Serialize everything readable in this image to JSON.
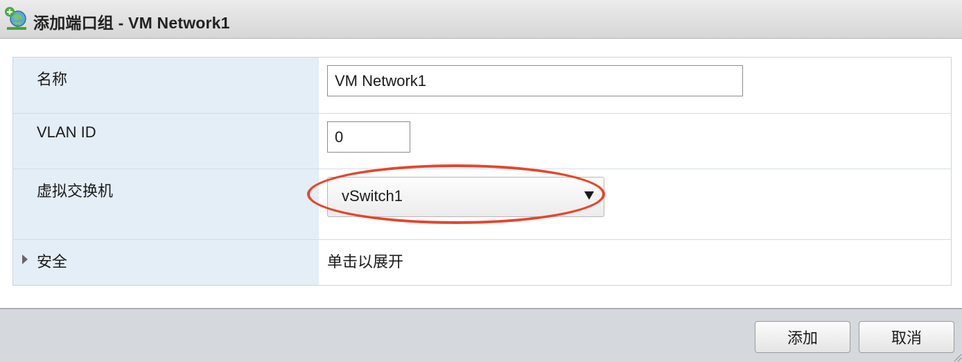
{
  "dialog": {
    "title": "添加端口组 - VM Network1",
    "icon": "network-add-icon"
  },
  "form": {
    "name": {
      "label": "名称",
      "value": "VM Network1"
    },
    "vlan_id": {
      "label": "VLAN ID",
      "value": "0"
    },
    "virtual_switch": {
      "label": "虚拟交换机",
      "selected": "vSwitch1"
    },
    "security": {
      "label": "安全",
      "expand_hint": "单击以展开"
    }
  },
  "footer": {
    "add_label": "添加",
    "cancel_label": "取消"
  },
  "colors": {
    "label_column_bg": "#e3eef6",
    "highlight": "#e8442a",
    "footer_bg": "#d5d9dd"
  }
}
